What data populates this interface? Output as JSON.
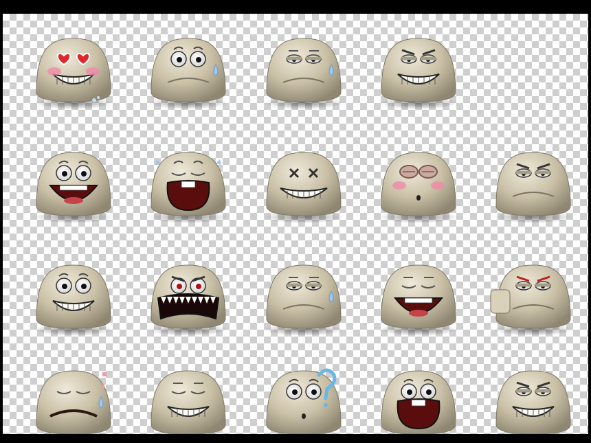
{
  "image": {
    "background": "transparency-checkerboard",
    "frame_color": "#000000",
    "body_color": "#cbc2a8",
    "body_highlight": "#ebe4d2",
    "body_shadow": "#8c8470"
  },
  "emoticons": [
    {
      "name": "in-love",
      "eyes": "hearts",
      "brows": "none",
      "mouth": "toothy-grin",
      "extras": [
        "pink-cheeks",
        "small-drops"
      ]
    },
    {
      "name": "surprised",
      "eyes": "wide",
      "brows": "raised",
      "mouth": "frown-line",
      "extras": [
        "sweat-drop"
      ]
    },
    {
      "name": "tearful",
      "eyes": "sleepy",
      "brows": "flat",
      "mouth": "frown-line",
      "extras": [
        "tear"
      ]
    },
    {
      "name": "angry",
      "eyes": "narrow",
      "brows": "angry",
      "mouth": "gritted",
      "extras": []
    },
    {
      "name": "empty-slot",
      "eyes": "none",
      "brows": "none",
      "mouth": "none",
      "extras": []
    },
    {
      "name": "laughing",
      "eyes": "wide",
      "brows": "raised",
      "mouth": "big-open",
      "extras": []
    },
    {
      "name": "crying",
      "eyes": "closed",
      "brows": "raised",
      "mouth": "scream",
      "extras": [
        "tears"
      ]
    },
    {
      "name": "knocked-out",
      "eyes": "x",
      "brows": "none",
      "mouth": "gritted-wide",
      "extras": []
    },
    {
      "name": "blushing",
      "eyes": "goggles",
      "brows": "none",
      "mouth": "tiny",
      "extras": [
        "pink-cheeks"
      ]
    },
    {
      "name": "sad",
      "eyes": "narrow",
      "brows": "angry",
      "mouth": "frown-line",
      "extras": []
    },
    {
      "name": "grinning",
      "eyes": "wide",
      "brows": "raised",
      "mouth": "toothy-grin",
      "extras": []
    },
    {
      "name": "furious",
      "eyes": "red",
      "brows": "angry",
      "mouth": "fangs",
      "extras": []
    },
    {
      "name": "worried",
      "eyes": "narrow",
      "brows": "flat",
      "mouth": "frown-line",
      "extras": [
        "sweat-drop"
      ]
    },
    {
      "name": "happy-laugh",
      "eyes": "closed",
      "brows": "flat",
      "mouth": "big-open",
      "extras": []
    },
    {
      "name": "thumbs-down",
      "eyes": "narrow",
      "brows": "red-angry",
      "mouth": "frown-line",
      "extras": [
        "thumb-down"
      ]
    },
    {
      "name": "dismayed",
      "eyes": "closed",
      "brows": "none",
      "mouth": "wide-frown",
      "extras": [
        "blue-drop",
        "pink-bits"
      ]
    },
    {
      "name": "smug-smile",
      "eyes": "closed",
      "brows": "flat",
      "mouth": "toothy-grin",
      "extras": []
    },
    {
      "name": "confused",
      "eyes": "wide",
      "brows": "raised",
      "mouth": "tiny",
      "extras": [
        "question-mark"
      ]
    },
    {
      "name": "shocked",
      "eyes": "wide",
      "brows": "raised",
      "mouth": "scream",
      "extras": []
    },
    {
      "name": "mischievous",
      "eyes": "narrow",
      "brows": "angry",
      "mouth": "toothy-grin",
      "extras": []
    }
  ]
}
